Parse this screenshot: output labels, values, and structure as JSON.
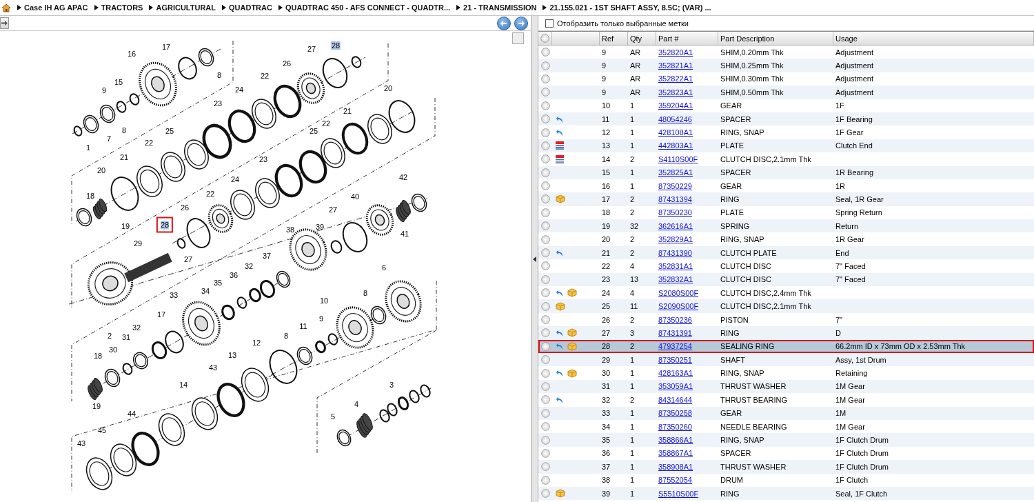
{
  "breadcrumb": [
    "Case IH AG APAC",
    "TRACTORS",
    "AGRICULTURAL",
    "QUADTRAC",
    "QUADTRAC 450 - AFS CONNECT - QUADTR...",
    "21 - TRANSMISSION",
    "21.155.021 - 1ST SHAFT ASSY, 8.5C; (VAR) ..."
  ],
  "filter": {
    "label": "Отобразить только выбранные метки",
    "checked": false
  },
  "diagram": {
    "callouts": [
      {
        "label": "16",
        "highlighted": false,
        "selected": false
      },
      {
        "label": "17",
        "highlighted": false,
        "selected": false
      },
      {
        "label": "8",
        "highlighted": false,
        "selected": false
      },
      {
        "label": "15",
        "highlighted": false,
        "selected": false
      },
      {
        "label": "9",
        "highlighted": false,
        "selected": false
      },
      {
        "label": "8",
        "highlighted": false,
        "selected": false
      },
      {
        "label": "7",
        "highlighted": false,
        "selected": false
      },
      {
        "label": "1",
        "highlighted": false,
        "selected": false
      },
      {
        "label": "27",
        "highlighted": false,
        "selected": false
      },
      {
        "label": "28",
        "highlighted": true,
        "selected": false
      },
      {
        "label": "26",
        "highlighted": false,
        "selected": false
      },
      {
        "label": "22",
        "highlighted": false,
        "selected": false
      },
      {
        "label": "24",
        "highlighted": false,
        "selected": false
      },
      {
        "label": "20",
        "highlighted": false,
        "selected": false
      },
      {
        "label": "23",
        "highlighted": false,
        "selected": false
      },
      {
        "label": "21",
        "highlighted": false,
        "selected": false
      },
      {
        "label": "25",
        "highlighted": false,
        "selected": false
      },
      {
        "label": "22",
        "highlighted": false,
        "selected": false
      },
      {
        "label": "25",
        "highlighted": false,
        "selected": false
      },
      {
        "label": "22",
        "highlighted": false,
        "selected": false
      },
      {
        "label": "21",
        "highlighted": false,
        "selected": false
      },
      {
        "label": "20",
        "highlighted": false,
        "selected": false
      },
      {
        "label": "23",
        "highlighted": false,
        "selected": false
      },
      {
        "label": "24",
        "highlighted": false,
        "selected": false
      },
      {
        "label": "18",
        "highlighted": false,
        "selected": false
      },
      {
        "label": "19",
        "highlighted": false,
        "selected": false
      },
      {
        "label": "22",
        "highlighted": false,
        "selected": false
      },
      {
        "label": "26",
        "highlighted": false,
        "selected": false
      },
      {
        "label": "42",
        "highlighted": false,
        "selected": false
      },
      {
        "label": "40",
        "highlighted": false,
        "selected": false
      },
      {
        "label": "28",
        "highlighted": true,
        "selected": true
      },
      {
        "label": "27",
        "highlighted": false,
        "selected": false
      },
      {
        "label": "38",
        "highlighted": false,
        "selected": false
      },
      {
        "label": "39",
        "highlighted": false,
        "selected": false
      },
      {
        "label": "41",
        "highlighted": false,
        "selected": false
      },
      {
        "label": "29",
        "highlighted": false,
        "selected": false
      },
      {
        "label": "27",
        "highlighted": false,
        "selected": false
      },
      {
        "label": "37",
        "highlighted": false,
        "selected": false
      },
      {
        "label": "32",
        "highlighted": false,
        "selected": false
      },
      {
        "label": "6",
        "highlighted": false,
        "selected": false
      },
      {
        "label": "36",
        "highlighted": false,
        "selected": false
      },
      {
        "label": "35",
        "highlighted": false,
        "selected": false
      },
      {
        "label": "34",
        "highlighted": false,
        "selected": false
      },
      {
        "label": "33",
        "highlighted": false,
        "selected": false
      },
      {
        "label": "8",
        "highlighted": false,
        "selected": false
      },
      {
        "label": "10",
        "highlighted": false,
        "selected": false
      },
      {
        "label": "17",
        "highlighted": false,
        "selected": false
      },
      {
        "label": "32",
        "highlighted": false,
        "selected": false
      },
      {
        "label": "31",
        "highlighted": false,
        "selected": false
      },
      {
        "label": "30",
        "highlighted": false,
        "selected": false
      },
      {
        "label": "18",
        "highlighted": false,
        "selected": false
      },
      {
        "label": "9",
        "highlighted": false,
        "selected": false
      },
      {
        "label": "11",
        "highlighted": false,
        "selected": false
      },
      {
        "label": "8",
        "highlighted": false,
        "selected": false
      },
      {
        "label": "12",
        "highlighted": false,
        "selected": false
      },
      {
        "label": "13",
        "highlighted": false,
        "selected": false
      },
      {
        "label": "43",
        "highlighted": false,
        "selected": false
      },
      {
        "label": "14",
        "highlighted": false,
        "selected": false
      },
      {
        "label": "19",
        "highlighted": false,
        "selected": false
      },
      {
        "label": "2",
        "highlighted": false,
        "selected": false
      },
      {
        "label": "3",
        "highlighted": false,
        "selected": false
      },
      {
        "label": "4",
        "highlighted": false,
        "selected": false
      },
      {
        "label": "5",
        "highlighted": false,
        "selected": false
      },
      {
        "label": "44",
        "highlighted": false,
        "selected": false
      },
      {
        "label": "45",
        "highlighted": false,
        "selected": false
      },
      {
        "label": "43",
        "highlighted": false,
        "selected": false
      }
    ]
  },
  "table": {
    "columns": [
      "Ref",
      "Qty",
      "Part #",
      "Part Description",
      "Usage"
    ],
    "rows": [
      {
        "ref": "9",
        "qty": "AR",
        "part": "352820A1",
        "description": "SHIM,0.20mm Thk",
        "usage": "Adjustment",
        "arrow": false,
        "box": false,
        "list": false,
        "selected": false
      },
      {
        "ref": "9",
        "qty": "AR",
        "part": "352821A1",
        "description": "SHIM,0.25mm Thk",
        "usage": "Adjustment",
        "arrow": false,
        "box": false,
        "list": false,
        "selected": false
      },
      {
        "ref": "9",
        "qty": "AR",
        "part": "352822A1",
        "description": "SHIM,0.30mm Thk",
        "usage": "Adjustment",
        "arrow": false,
        "box": false,
        "list": false,
        "selected": false
      },
      {
        "ref": "9",
        "qty": "AR",
        "part": "352823A1",
        "description": "SHIM,0.50mm Thk",
        "usage": "Adjustment",
        "arrow": false,
        "box": false,
        "list": false,
        "selected": false
      },
      {
        "ref": "10",
        "qty": "1",
        "part": "359204A1",
        "description": "GEAR",
        "usage": "1F",
        "arrow": false,
        "box": false,
        "list": false,
        "selected": false
      },
      {
        "ref": "11",
        "qty": "1",
        "part": "48054246",
        "description": "SPACER",
        "usage": "1F Bearing",
        "arrow": true,
        "box": false,
        "list": false,
        "selected": false
      },
      {
        "ref": "12",
        "qty": "1",
        "part": "428108A1",
        "description": "RING, SNAP",
        "usage": "1F Gear",
        "arrow": true,
        "box": false,
        "list": false,
        "selected": false
      },
      {
        "ref": "13",
        "qty": "1",
        "part": "442803A1",
        "description": "PLATE",
        "usage": "Clutch End",
        "arrow": false,
        "box": false,
        "list": true,
        "selected": false
      },
      {
        "ref": "14",
        "qty": "2",
        "part": "S4110S00F",
        "description": "CLUTCH DISC,2.1mm Thk",
        "arrow": false,
        "box": false,
        "list": true,
        "selected": false
      },
      {
        "ref": "15",
        "qty": "1",
        "part": "352825A1",
        "description": "SPACER",
        "usage": "1R Bearing",
        "arrow": false,
        "box": false,
        "list": false,
        "selected": false
      },
      {
        "ref": "16",
        "qty": "1",
        "part": "87350229",
        "description": "GEAR",
        "usage": "1R",
        "arrow": false,
        "box": false,
        "list": false,
        "selected": false
      },
      {
        "ref": "17",
        "qty": "2",
        "part": "87431394",
        "description": "RING",
        "usage": "Seal, 1R Gear",
        "arrow": false,
        "box": true,
        "list": false,
        "selected": false
      },
      {
        "ref": "18",
        "qty": "2",
        "part": "87350230",
        "description": "PLATE",
        "usage": "Spring Return",
        "arrow": false,
        "box": false,
        "list": false,
        "selected": false
      },
      {
        "ref": "19",
        "qty": "32",
        "part": "362616A1",
        "description": "SPRING",
        "usage": "Return",
        "arrow": false,
        "box": false,
        "list": false,
        "selected": false
      },
      {
        "ref": "20",
        "qty": "2",
        "part": "352829A1",
        "description": "RING, SNAP",
        "usage": "1R Gear",
        "arrow": false,
        "box": false,
        "list": false,
        "selected": false
      },
      {
        "ref": "21",
        "qty": "2",
        "part": "87431390",
        "description": "CLUTCH PLATE",
        "usage": "End",
        "arrow": true,
        "box": false,
        "list": false,
        "selected": false
      },
      {
        "ref": "22",
        "qty": "4",
        "part": "352831A1",
        "description": "CLUTCH DISC",
        "usage": "7\" Faced",
        "arrow": false,
        "box": false,
        "list": false,
        "selected": false
      },
      {
        "ref": "23",
        "qty": "13",
        "part": "352832A1",
        "description": "CLUTCH DISC",
        "usage": "7\" Faced",
        "arrow": false,
        "box": false,
        "list": false,
        "selected": false
      },
      {
        "ref": "24",
        "qty": "4",
        "part": "S2080S00F",
        "description": "CLUTCH DISC,2.4mm Thk",
        "arrow": true,
        "box": true,
        "list": false,
        "selected": false
      },
      {
        "ref": "25",
        "qty": "11",
        "part": "S2090S00F",
        "description": "CLUTCH DISC,2.1mm Thk",
        "arrow": false,
        "box": true,
        "list": false,
        "selected": false
      },
      {
        "ref": "26",
        "qty": "2",
        "part": "87350236",
        "description": "PISTON",
        "usage": "7\"",
        "arrow": false,
        "box": false,
        "list": false,
        "selected": false
      },
      {
        "ref": "27",
        "qty": "3",
        "part": "87431391",
        "description": "RING",
        "usage": "D",
        "arrow": true,
        "box": true,
        "list": false,
        "selected": false
      },
      {
        "ref": "28",
        "qty": "2",
        "part": "47937254",
        "description": "SEALING RING",
        "usage": "66.2mm ID x 73mm OD x 2.53mm Thk",
        "arrow": true,
        "box": true,
        "list": false,
        "selected": true
      },
      {
        "ref": "29",
        "qty": "1",
        "part": "87350251",
        "description": "SHAFT",
        "usage": "Assy, 1st Drum",
        "arrow": false,
        "box": false,
        "list": false,
        "selected": false
      },
      {
        "ref": "30",
        "qty": "1",
        "part": "428163A1",
        "description": "RING, SNAP",
        "usage": "Retaining",
        "arrow": true,
        "box": true,
        "list": false,
        "selected": false
      },
      {
        "ref": "31",
        "qty": "1",
        "part": "353059A1",
        "description": "THRUST WASHER",
        "usage": "1M Gear",
        "arrow": false,
        "box": false,
        "list": false,
        "selected": false
      },
      {
        "ref": "32",
        "qty": "2",
        "part": "84314644",
        "description": "THRUST BEARING",
        "usage": "1M Gear",
        "arrow": true,
        "box": false,
        "list": false,
        "selected": false
      },
      {
        "ref": "33",
        "qty": "1",
        "part": "87350258",
        "description": "GEAR",
        "usage": "1M",
        "arrow": false,
        "box": false,
        "list": false,
        "selected": false
      },
      {
        "ref": "34",
        "qty": "1",
        "part": "87350260",
        "description": "NEEDLE BEARING",
        "usage": "1M Gear",
        "arrow": false,
        "box": false,
        "list": false,
        "selected": false
      },
      {
        "ref": "35",
        "qty": "1",
        "part": "358866A1",
        "description": "RING, SNAP",
        "usage": "1F Clutch Drum",
        "arrow": false,
        "box": false,
        "list": false,
        "selected": false
      },
      {
        "ref": "36",
        "qty": "1",
        "part": "358867A1",
        "description": "SPACER",
        "usage": "1F Clutch Drum",
        "arrow": false,
        "box": false,
        "list": false,
        "selected": false
      },
      {
        "ref": "37",
        "qty": "1",
        "part": "358908A1",
        "description": "THRUST WASHER",
        "usage": "1F Clutch Drum",
        "arrow": false,
        "box": false,
        "list": false,
        "selected": false
      },
      {
        "ref": "38",
        "qty": "1",
        "part": "87552054",
        "description": "DRUM",
        "usage": "1F Clutch",
        "arrow": false,
        "box": false,
        "list": false,
        "selected": false
      },
      {
        "ref": "39",
        "qty": "1",
        "part": "S5510S00F",
        "description": "RING",
        "usage": "Seal, 1F Clutch",
        "arrow": false,
        "box": true,
        "list": false,
        "selected": false
      }
    ]
  }
}
